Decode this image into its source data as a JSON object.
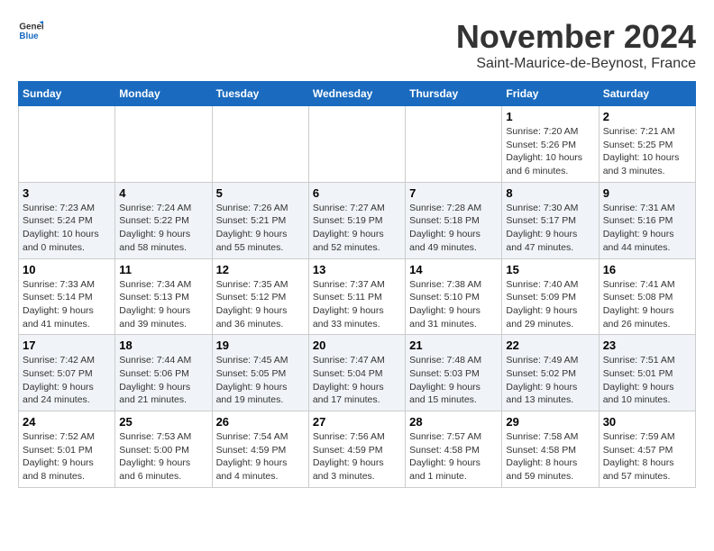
{
  "header": {
    "logo": {
      "general": "General",
      "blue": "Blue",
      "tagline": ""
    },
    "title": "November 2024",
    "location": "Saint-Maurice-de-Beynost, France"
  },
  "weekdays": [
    "Sunday",
    "Monday",
    "Tuesday",
    "Wednesday",
    "Thursday",
    "Friday",
    "Saturday"
  ],
  "weeks": [
    [
      {
        "day": "",
        "info": ""
      },
      {
        "day": "",
        "info": ""
      },
      {
        "day": "",
        "info": ""
      },
      {
        "day": "",
        "info": ""
      },
      {
        "day": "",
        "info": ""
      },
      {
        "day": "1",
        "info": "Sunrise: 7:20 AM\nSunset: 5:26 PM\nDaylight: 10 hours and 6 minutes."
      },
      {
        "day": "2",
        "info": "Sunrise: 7:21 AM\nSunset: 5:25 PM\nDaylight: 10 hours and 3 minutes."
      }
    ],
    [
      {
        "day": "3",
        "info": "Sunrise: 7:23 AM\nSunset: 5:24 PM\nDaylight: 10 hours and 0 minutes."
      },
      {
        "day": "4",
        "info": "Sunrise: 7:24 AM\nSunset: 5:22 PM\nDaylight: 9 hours and 58 minutes."
      },
      {
        "day": "5",
        "info": "Sunrise: 7:26 AM\nSunset: 5:21 PM\nDaylight: 9 hours and 55 minutes."
      },
      {
        "day": "6",
        "info": "Sunrise: 7:27 AM\nSunset: 5:19 PM\nDaylight: 9 hours and 52 minutes."
      },
      {
        "day": "7",
        "info": "Sunrise: 7:28 AM\nSunset: 5:18 PM\nDaylight: 9 hours and 49 minutes."
      },
      {
        "day": "8",
        "info": "Sunrise: 7:30 AM\nSunset: 5:17 PM\nDaylight: 9 hours and 47 minutes."
      },
      {
        "day": "9",
        "info": "Sunrise: 7:31 AM\nSunset: 5:16 PM\nDaylight: 9 hours and 44 minutes."
      }
    ],
    [
      {
        "day": "10",
        "info": "Sunrise: 7:33 AM\nSunset: 5:14 PM\nDaylight: 9 hours and 41 minutes."
      },
      {
        "day": "11",
        "info": "Sunrise: 7:34 AM\nSunset: 5:13 PM\nDaylight: 9 hours and 39 minutes."
      },
      {
        "day": "12",
        "info": "Sunrise: 7:35 AM\nSunset: 5:12 PM\nDaylight: 9 hours and 36 minutes."
      },
      {
        "day": "13",
        "info": "Sunrise: 7:37 AM\nSunset: 5:11 PM\nDaylight: 9 hours and 33 minutes."
      },
      {
        "day": "14",
        "info": "Sunrise: 7:38 AM\nSunset: 5:10 PM\nDaylight: 9 hours and 31 minutes."
      },
      {
        "day": "15",
        "info": "Sunrise: 7:40 AM\nSunset: 5:09 PM\nDaylight: 9 hours and 29 minutes."
      },
      {
        "day": "16",
        "info": "Sunrise: 7:41 AM\nSunset: 5:08 PM\nDaylight: 9 hours and 26 minutes."
      }
    ],
    [
      {
        "day": "17",
        "info": "Sunrise: 7:42 AM\nSunset: 5:07 PM\nDaylight: 9 hours and 24 minutes."
      },
      {
        "day": "18",
        "info": "Sunrise: 7:44 AM\nSunset: 5:06 PM\nDaylight: 9 hours and 21 minutes."
      },
      {
        "day": "19",
        "info": "Sunrise: 7:45 AM\nSunset: 5:05 PM\nDaylight: 9 hours and 19 minutes."
      },
      {
        "day": "20",
        "info": "Sunrise: 7:47 AM\nSunset: 5:04 PM\nDaylight: 9 hours and 17 minutes."
      },
      {
        "day": "21",
        "info": "Sunrise: 7:48 AM\nSunset: 5:03 PM\nDaylight: 9 hours and 15 minutes."
      },
      {
        "day": "22",
        "info": "Sunrise: 7:49 AM\nSunset: 5:02 PM\nDaylight: 9 hours and 13 minutes."
      },
      {
        "day": "23",
        "info": "Sunrise: 7:51 AM\nSunset: 5:01 PM\nDaylight: 9 hours and 10 minutes."
      }
    ],
    [
      {
        "day": "24",
        "info": "Sunrise: 7:52 AM\nSunset: 5:01 PM\nDaylight: 9 hours and 8 minutes."
      },
      {
        "day": "25",
        "info": "Sunrise: 7:53 AM\nSunset: 5:00 PM\nDaylight: 9 hours and 6 minutes."
      },
      {
        "day": "26",
        "info": "Sunrise: 7:54 AM\nSunset: 4:59 PM\nDaylight: 9 hours and 4 minutes."
      },
      {
        "day": "27",
        "info": "Sunrise: 7:56 AM\nSunset: 4:59 PM\nDaylight: 9 hours and 3 minutes."
      },
      {
        "day": "28",
        "info": "Sunrise: 7:57 AM\nSunset: 4:58 PM\nDaylight: 9 hours and 1 minute."
      },
      {
        "day": "29",
        "info": "Sunrise: 7:58 AM\nSunset: 4:58 PM\nDaylight: 8 hours and 59 minutes."
      },
      {
        "day": "30",
        "info": "Sunrise: 7:59 AM\nSunset: 4:57 PM\nDaylight: 8 hours and 57 minutes."
      }
    ]
  ]
}
